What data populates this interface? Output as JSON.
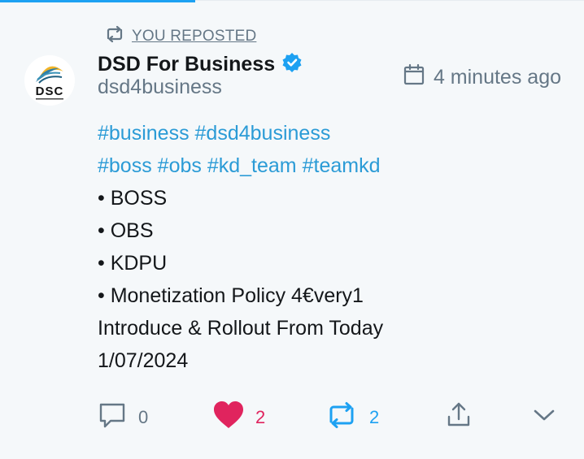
{
  "repost": {
    "label": "YOU REPOSTED"
  },
  "author": {
    "name": "DSD For Business",
    "handle": "dsd4business",
    "verified": true,
    "avatar_text": "DSC"
  },
  "timestamp": "4 minutes ago",
  "post": {
    "hashtags_line1": [
      "#business",
      "#dsd4business"
    ],
    "hashtags_line2": [
      "#boss",
      "#obs",
      "#kd_team",
      "#teamkd"
    ],
    "bullets": [
      "• BOSS",
      "• OBS",
      "• KDPU",
      "• Monetization Policy 4€very1"
    ],
    "lines": [
      "Introduce & Rollout From Today",
      "1/07/2024"
    ]
  },
  "actions": {
    "reply_count": "0",
    "like_count": "2",
    "repost_count": "2"
  },
  "colors": {
    "accent": "#1da1f2",
    "like": "#e0245e",
    "hashtag": "#2b9bd6",
    "muted": "#657786"
  }
}
